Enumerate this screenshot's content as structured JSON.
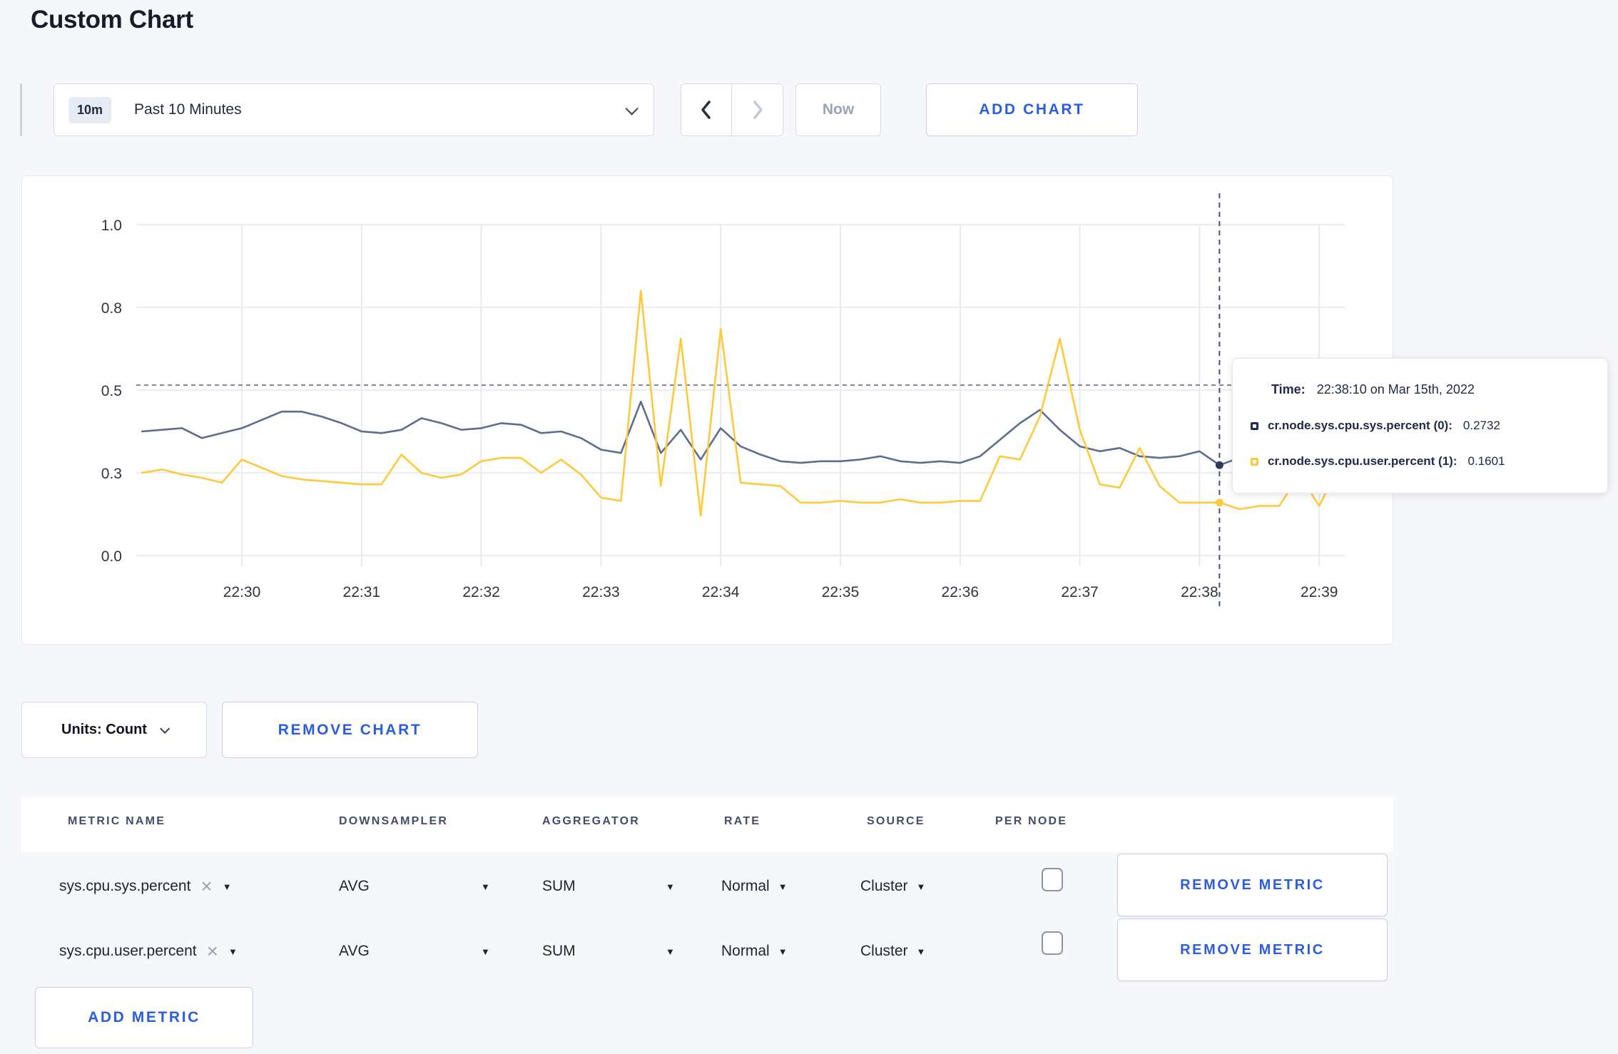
{
  "page": {
    "title": "Custom Chart"
  },
  "toolbar": {
    "time_window_badge": "10m",
    "time_window_label": "Past 10 Minutes",
    "now_label": "Now",
    "add_chart_label": "ADD CHART"
  },
  "chart_data": {
    "type": "line",
    "title": "",
    "ylim": [
      0,
      1
    ],
    "grid": true,
    "y_ticks": [
      {
        "value": 0,
        "label": "0.0"
      },
      {
        "value": 0.25,
        "label": "0.3"
      },
      {
        "value": 0.5,
        "label": "0.5"
      },
      {
        "value": 0.75,
        "label": "0.8"
      },
      {
        "value": 1,
        "label": "1.0"
      }
    ],
    "x_ticks": [
      "22:30",
      "22:31",
      "22:32",
      "22:33",
      "22:34",
      "22:35",
      "22:36",
      "22:37",
      "22:38",
      "22:39"
    ],
    "x_start": "22:29:10",
    "x_interval_seconds": 10,
    "guide_value": 0.515,
    "crosshair": {
      "time": "22:38:10",
      "values": [
        0.2732,
        0.1601
      ]
    },
    "series": [
      {
        "name": "cr.node.sys.cpu.sys.percent",
        "color": "#5d6d8e",
        "marker_color": "#2e3b5e",
        "values": [
          0.375,
          0.38,
          0.385,
          0.355,
          0.37,
          0.385,
          0.41,
          0.435,
          0.435,
          0.42,
          0.4,
          0.375,
          0.37,
          0.38,
          0.415,
          0.4,
          0.38,
          0.385,
          0.4,
          0.395,
          0.37,
          0.375,
          0.355,
          0.32,
          0.31,
          0.465,
          0.31,
          0.38,
          0.29,
          0.385,
          0.33,
          0.305,
          0.285,
          0.28,
          0.285,
          0.285,
          0.29,
          0.3,
          0.285,
          0.28,
          0.285,
          0.28,
          0.3,
          0.35,
          0.4,
          0.44,
          0.38,
          0.33,
          0.315,
          0.325,
          0.3,
          0.295,
          0.3,
          0.315,
          0.2732,
          0.295,
          0.31,
          0.3,
          0.295,
          0.3,
          0.26
        ]
      },
      {
        "name": "cr.node.sys.cpu.user.percent",
        "color": "#ffc93e",
        "marker_color": "#ffc93e",
        "values": [
          0.25,
          0.26,
          0.245,
          0.235,
          0.22,
          0.29,
          0.265,
          0.24,
          0.23,
          0.225,
          0.22,
          0.215,
          0.215,
          0.305,
          0.25,
          0.235,
          0.245,
          0.285,
          0.295,
          0.295,
          0.25,
          0.29,
          0.245,
          0.175,
          0.165,
          0.8,
          0.21,
          0.655,
          0.12,
          0.685,
          0.22,
          0.215,
          0.21,
          0.16,
          0.16,
          0.165,
          0.16,
          0.16,
          0.17,
          0.16,
          0.16,
          0.165,
          0.165,
          0.3,
          0.29,
          0.42,
          0.655,
          0.38,
          0.215,
          0.205,
          0.325,
          0.21,
          0.16,
          0.16,
          0.1601,
          0.14,
          0.15,
          0.15,
          0.245,
          0.15,
          0.27
        ]
      }
    ]
  },
  "tooltip": {
    "time_label": "Time:",
    "time_value": "22:38:10 on Mar 15th, 2022",
    "rows": [
      {
        "name": "cr.node.sys.cpu.sys.percent (0):",
        "value": "0.2732",
        "color": "#222c55"
      },
      {
        "name": "cr.node.sys.cpu.user.percent (1):",
        "value": "0.1601",
        "color": "#ffc93e"
      }
    ]
  },
  "chart_footer": {
    "units_label": "Units: Count",
    "remove_chart_label": "REMOVE CHART"
  },
  "metrics": {
    "headers": [
      "METRIC NAME",
      "DOWNSAMPLER",
      "AGGREGATOR",
      "RATE",
      "SOURCE",
      "PER NODE"
    ],
    "rows": [
      {
        "name": "sys.cpu.sys.percent",
        "downsampler": "AVG",
        "aggregator": "SUM",
        "rate": "Normal",
        "source": "Cluster",
        "per_node_checked": false,
        "remove_label": "REMOVE METRIC"
      },
      {
        "name": "sys.cpu.user.percent",
        "downsampler": "AVG",
        "aggregator": "SUM",
        "rate": "Normal",
        "source": "Cluster",
        "per_node_checked": false,
        "remove_label": "REMOVE METRIC"
      }
    ],
    "add_metric_label": "ADD METRIC"
  }
}
